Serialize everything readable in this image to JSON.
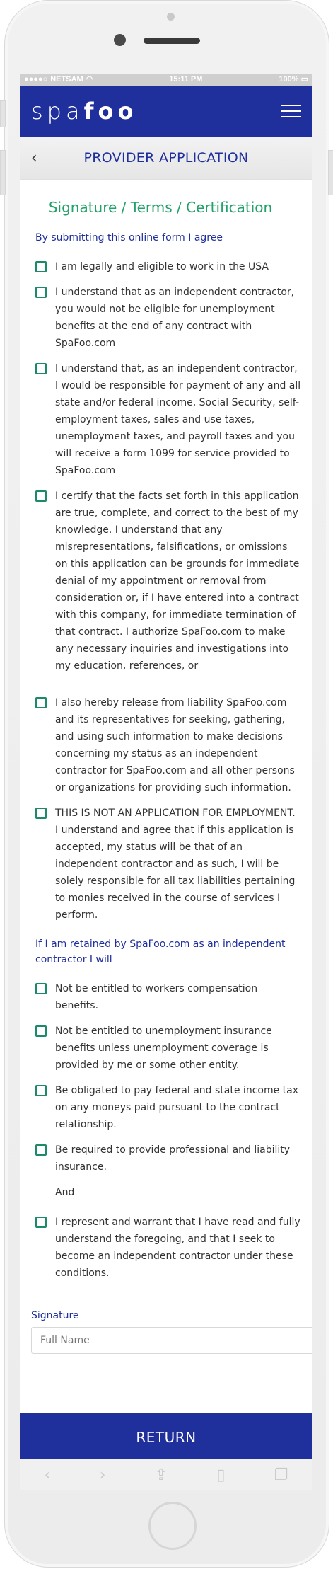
{
  "status_bar": {
    "carrier": "NETSAM",
    "signal": "●●●●○",
    "wifi": "wifi-icon",
    "time": "15:11 PM",
    "battery": "100%"
  },
  "app": {
    "logo_text": "spafoo",
    "menu_icon": "hamburger-icon"
  },
  "header": {
    "back_icon": "chevron-left-icon",
    "title": "PROVIDER APPLICATION"
  },
  "section_title": "Signature / Terms / Certification",
  "intro": "By submitting this online form I agree",
  "terms": [
    "I am legally and eligible to work in the USA",
    "I understand that as an independent contractor, you would not be eligible for unemployment benefits at the end of any contract with SpaFoo.com",
    "I understand that, as an independent contractor, I would be responsible for payment of any and all state and/or federal income, Social Security, self-employment taxes, sales and use taxes, unemployment taxes, and payroll taxes and you will receive a form 1099 for service provided to SpaFoo.com",
    "I certify that the facts set forth in this application are true, complete, and correct to the best of my knowledge. I understand that any misrepresentations, falsifications, or omissions on this application can be grounds for immediate denial of my appointment or removal from consideration or, if I have entered into a contract with this company, for immediate termination of that contract. I authorize SpaFoo.com to make any necessary inquiries and investigations into my education, references, or",
    "I also hereby release from liability SpaFoo.com and its representatives for seeking, gathering, and using such information to make decisions concerning my status as an independent contractor for SpaFoo.com and all other persons or organizations for providing such information.",
    "THIS IS NOT AN APPLICATION FOR EMPLOYMENT. I understand and agree that if this application is accepted, my status will be that of an independent contractor and as such, I will be solely responsible for all tax liabilities pertaining to monies received in the course of services I perform."
  ],
  "retained_intro": "If I am retained by SpaFoo.com as an independent contractor I will",
  "retained": [
    "Not be entitled to workers compensation benefits.",
    "Not be entitled to unemployment insurance benefits unless unemployment coverage is provided by me or some other entity.",
    "Be obligated to pay federal and state income tax on any moneys paid pursuant to the contract relationship.",
    "Be required to provide professional and liability insurance."
  ],
  "and_text": "And",
  "final_statement": "I represent and warrant that I have read and fully understand the foregoing, and that I seek to become an independent contractor under these conditions.",
  "signature": {
    "label": "Signature",
    "placeholder": "Full Name",
    "value": ""
  },
  "return_button": "RETURN",
  "browser_toolbar": {
    "back": "‹",
    "forward": "›",
    "share": "⇪",
    "bookmarks": "▯",
    "tabs": "❐"
  }
}
